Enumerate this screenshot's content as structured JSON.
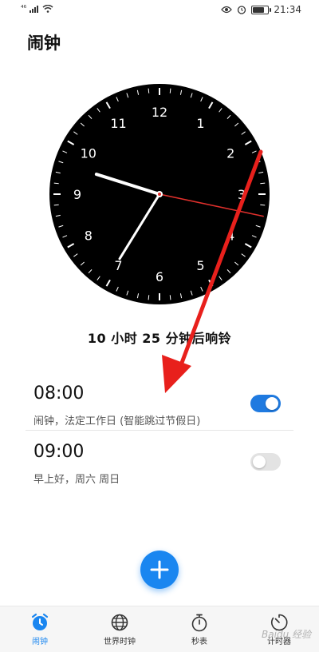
{
  "status_bar": {
    "signal": "⁴⁶",
    "time": "21:34",
    "battery_level": 0.8
  },
  "app": {
    "title": "闹钟"
  },
  "clock": {
    "hour_numerals": [
      "12",
      "1",
      "2",
      "3",
      "4",
      "5",
      "6",
      "7",
      "8",
      "9",
      "10",
      "11"
    ],
    "time_shown": {
      "hour": 9,
      "minute": 35,
      "second": 17
    }
  },
  "countdown": {
    "text": "10 小时 25 分钟后响铃"
  },
  "alarms": [
    {
      "time": "08:00",
      "label": "闹钟，法定工作日 (智能跳过节假日)",
      "enabled": true
    },
    {
      "time": "09:00",
      "label": "早上好，周六 周日",
      "enabled": false
    }
  ],
  "fab": {
    "icon": "plus-icon"
  },
  "bottom_nav": [
    {
      "label": "闹钟",
      "icon": "alarm-clock-icon",
      "active": true
    },
    {
      "label": "世界时钟",
      "icon": "globe-icon",
      "active": false
    },
    {
      "label": "秒表",
      "icon": "stopwatch-icon",
      "active": false
    },
    {
      "label": "计时器",
      "icon": "timer-icon",
      "active": false
    }
  ],
  "colors": {
    "accent": "#1a86f0",
    "toggle_on": "#1f7ae0",
    "second_hand": "#e0302c",
    "annotation_arrow": "#e8201c",
    "clock_face": "#000000"
  },
  "watermark": "Baidu 经验"
}
